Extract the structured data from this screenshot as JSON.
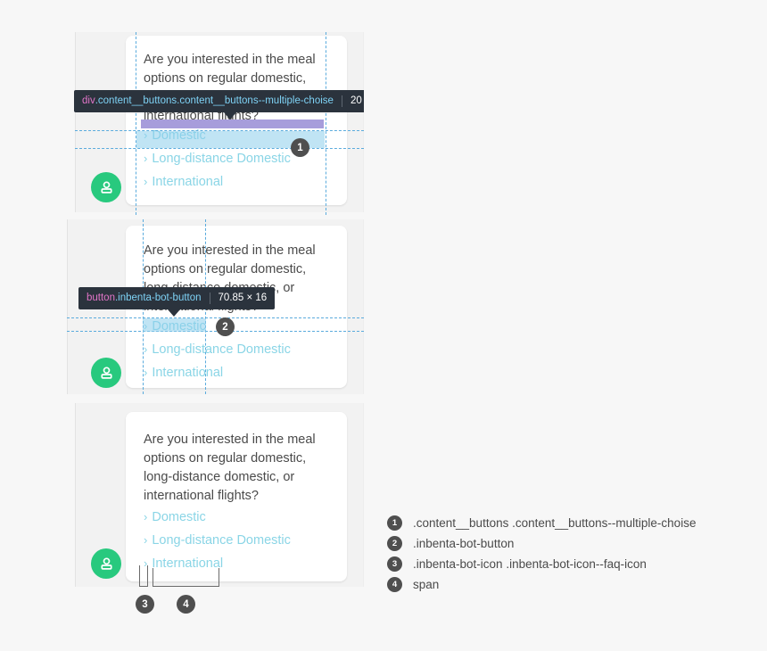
{
  "theme": {
    "page_bg": "#f7f7f7",
    "panel_bg": "#f2f2f2",
    "bubble_bg": "#ffffff",
    "text_color": "#4a4a4a",
    "link_color": "#8ad5e6",
    "avatar_bg": "#28c97e",
    "badge_bg": "#4f4f4f",
    "guide_color": "#5aabdd",
    "highlight_content": "#8ccdeb",
    "highlight_margin": "#a79ddb",
    "tooltip_bg": "#2b333d",
    "tooltip_tag": "#e175c8",
    "tooltip_class": "#7ed2f5"
  },
  "chat": {
    "question": "Are you interested in the meal options on regular domestic, long-distance domestic, or international flights?",
    "chevron": "›",
    "choices": [
      "Domestic",
      "Long-distance Domestic",
      "International"
    ],
    "avatar_icon": "bot-avatar-icon"
  },
  "panels": [
    {
      "id": "panel-1",
      "tooltip": {
        "tag": "div",
        "classes": ".content__buttons.content__buttons--multiple-choise",
        "size": "20",
        "clipped": true
      },
      "badge": "1"
    },
    {
      "id": "panel-2",
      "tooltip": {
        "tag": "button",
        "classes": ".inbenta-bot-button",
        "size": "70.85 × 16",
        "clipped": false
      },
      "badge": "2"
    },
    {
      "id": "panel-3",
      "badges": [
        "3",
        "4"
      ]
    }
  ],
  "legend": {
    "items": [
      {
        "num": "1",
        "label": ".content__buttons .content__buttons--multiple-choise"
      },
      {
        "num": "2",
        "label": ".inbenta-bot-button"
      },
      {
        "num": "3",
        "label": ".inbenta-bot-icon .inbenta-bot-icon--faq-icon"
      },
      {
        "num": "4",
        "label": "span"
      }
    ]
  }
}
